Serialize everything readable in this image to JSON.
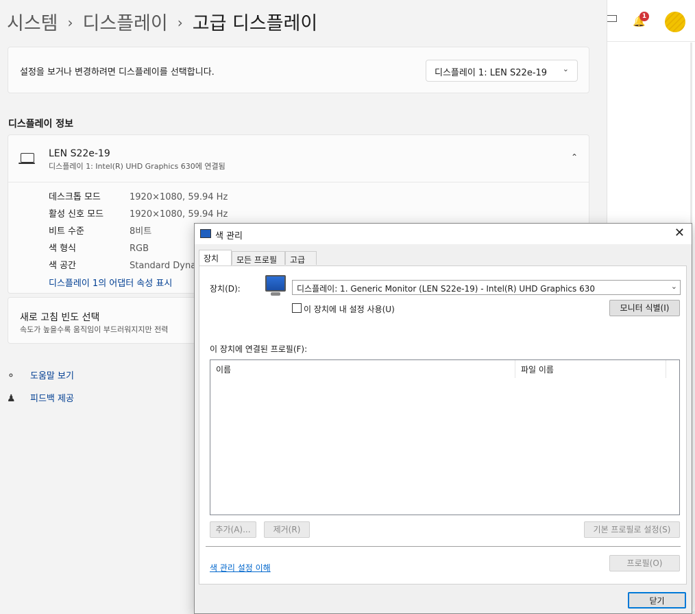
{
  "breadcrumb": {
    "part1": "시스템",
    "sep": "›",
    "part2": "디스플레이",
    "current": "고급 디스플레이"
  },
  "select_display": {
    "prompt": "설정을 보거나 변경하려면 디스플레이를 선택합니다.",
    "dropdown_value": "디스플레이 1: LEN S22e-19"
  },
  "display_info": {
    "heading": "디스플레이 정보",
    "device_name": "LEN S22e-19",
    "device_sub": "디스플레이 1: Intel(R) UHD Graphics 630에 연결됨",
    "rows": [
      {
        "key": "데스크톱 모드",
        "value": "1920×1080, 59.94 Hz"
      },
      {
        "key": "활성 신호 모드",
        "value": "1920×1080, 59.94 Hz"
      },
      {
        "key": "비트 수준",
        "value": "8비트"
      },
      {
        "key": "색 형식",
        "value": "RGB"
      },
      {
        "key": "색 공간",
        "value": "Standard Dyna"
      }
    ],
    "adapter_link": "디스플레이 1의 어댑터 속성 표시"
  },
  "refresh": {
    "title": "새로 고침 빈도 선택",
    "subtitle": "속도가 높을수록 움직임이 부드러워지지만 전력"
  },
  "help": {
    "get_help": "도움말 보기",
    "feedback": "피드백 제공"
  },
  "topbar": {
    "notification_count": "1"
  },
  "dialog": {
    "title": "색 관리",
    "tabs": [
      "장치",
      "모든 프로필",
      "고급"
    ],
    "device_label": "장치(D):",
    "device_value": "디스플레이: 1. Generic Monitor (LEN S22e-19) - Intel(R) UHD Graphics 630",
    "use_settings_label": "이 장치에 내 설정 사용(U)",
    "identify_button": "모니터 식별(I)",
    "profiles_label": "이 장치에 연결된 프로필(F):",
    "columns": [
      "이름",
      "파일 이름"
    ],
    "add_button": "추가(A)...",
    "remove_button": "제거(R)",
    "set_default_button": "기본 프로필로 설정(S)",
    "learn_link": "색 관리 설정 이해",
    "profiles_button": "프로필(O)",
    "close_button": "닫기"
  }
}
